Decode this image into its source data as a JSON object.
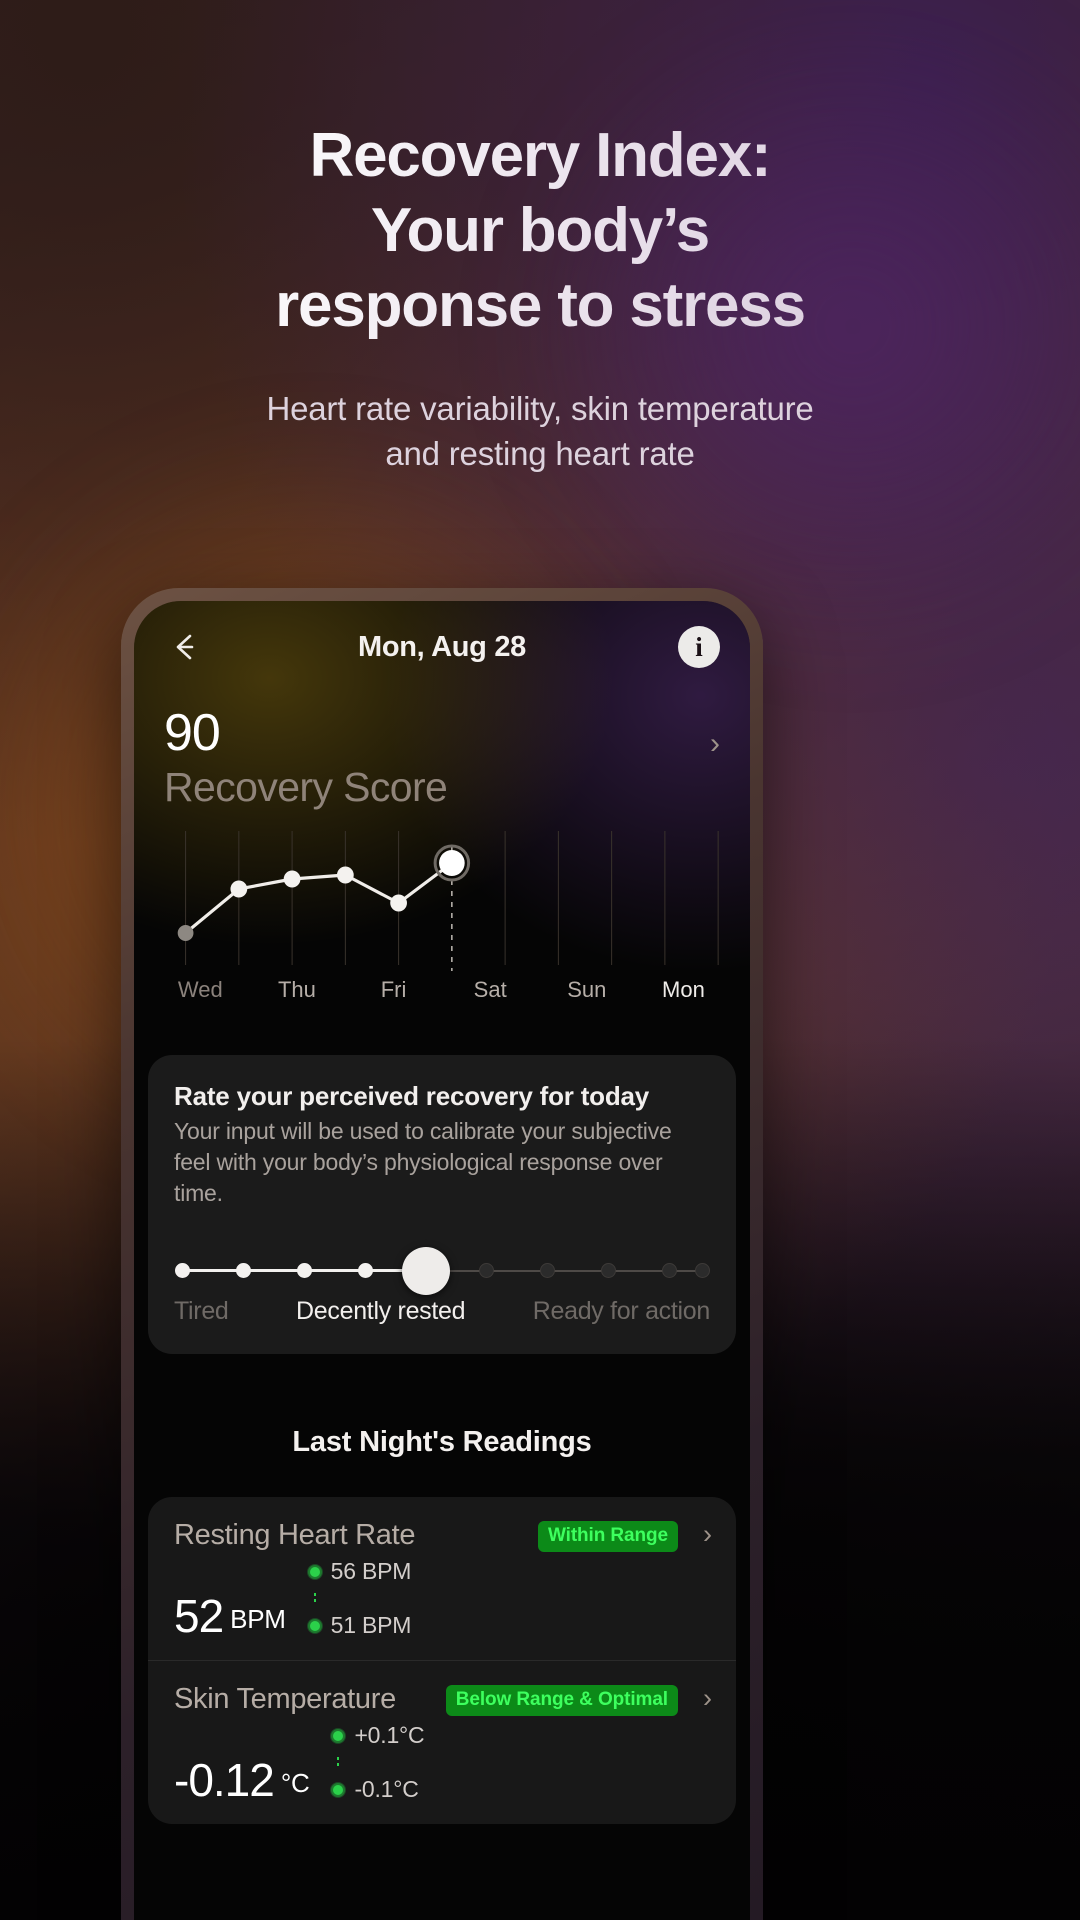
{
  "hero": {
    "title_line1": "Recovery Index:",
    "title_line2": "Your body’s",
    "title_line3": "response to stress",
    "subtitle_line1": "Heart rate variability, skin temperature",
    "subtitle_line2": "and resting heart rate"
  },
  "app": {
    "header": {
      "back_icon": "arrow-left-icon",
      "title": "Mon, Aug 28",
      "info_icon": "info-icon",
      "info_label": "i"
    },
    "score": {
      "value": "90",
      "label": "Recovery Score",
      "chevron": "›"
    },
    "chart": {
      "days": [
        "Wed",
        "Thu",
        "Fri",
        "Sat",
        "Sun",
        "Mon"
      ]
    },
    "rating_card": {
      "title": "Rate your perceived recovery for today",
      "description_line1": "Your input will be used to calibrate your subjective feel",
      "description_line2": "with your body’s physiological response over time.",
      "slider": {
        "steps": 10,
        "selected_index": 5,
        "left_label": "Tired",
        "center_label": "Decently rested",
        "right_label": "Ready for action"
      }
    },
    "readings": {
      "title": "Last Night's Readings",
      "rows": [
        {
          "name": "Resting Heart Rate",
          "value": "52",
          "unit": "BPM",
          "range_high": "56 BPM",
          "range_low": "51 BPM",
          "badge": "Within Range",
          "chevron": "›"
        },
        {
          "name": "Skin Temperature",
          "value": "-0.12",
          "unit": "°C",
          "range_high": "+0.1°C",
          "range_low": "-0.1°C",
          "badge": "Below Range & Optimal",
          "chevron": "›"
        }
      ]
    }
  },
  "chart_data": {
    "type": "line",
    "title": "Recovery Score",
    "categories": [
      "Wed",
      "Thu",
      "Fri",
      "Sat",
      "Sun",
      "Mon"
    ],
    "values": [
      52,
      78,
      83,
      85,
      70,
      90
    ],
    "highlight_index": 5,
    "xlabel": "",
    "ylabel": "",
    "ylim": [
      40,
      100
    ],
    "grid": true,
    "legend": "none"
  },
  "colors": {
    "badge_bg": "#0c8a18",
    "badge_text": "#3dff5e",
    "range_dot": "#2bd14a",
    "accent_white": "#ffffff"
  }
}
